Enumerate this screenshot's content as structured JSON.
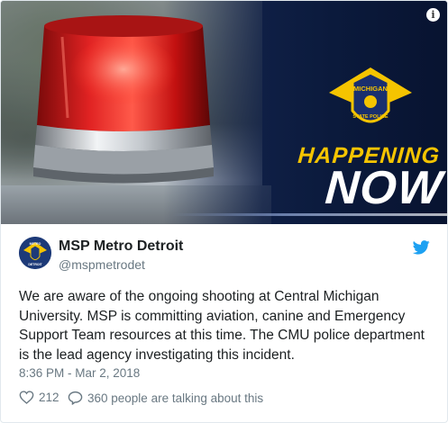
{
  "banner": {
    "badge_text": "MICHIGAN STATE POLICE",
    "headline_top": "HAPPENING",
    "headline_main": "NOW",
    "info_icon": "info-icon"
  },
  "tweet": {
    "display_name": "MSP Metro Detroit",
    "handle": "@mspmetrodet",
    "avatar_text": "METRO DETROIT",
    "text": "We are aware of the ongoing shooting at Central Michigan University. MSP is committing aviation, canine and Emergency Support Team resources at this time. The CMU police department is the lead agency investigating this incident.",
    "timestamp": "8:36 PM - Mar 2, 2018",
    "like_count": "212",
    "reply_text": "360 people are talking about this"
  },
  "colors": {
    "twitter_blue": "#1da1f2",
    "headline_yellow": "#f5c400",
    "muted_text": "#697882"
  }
}
